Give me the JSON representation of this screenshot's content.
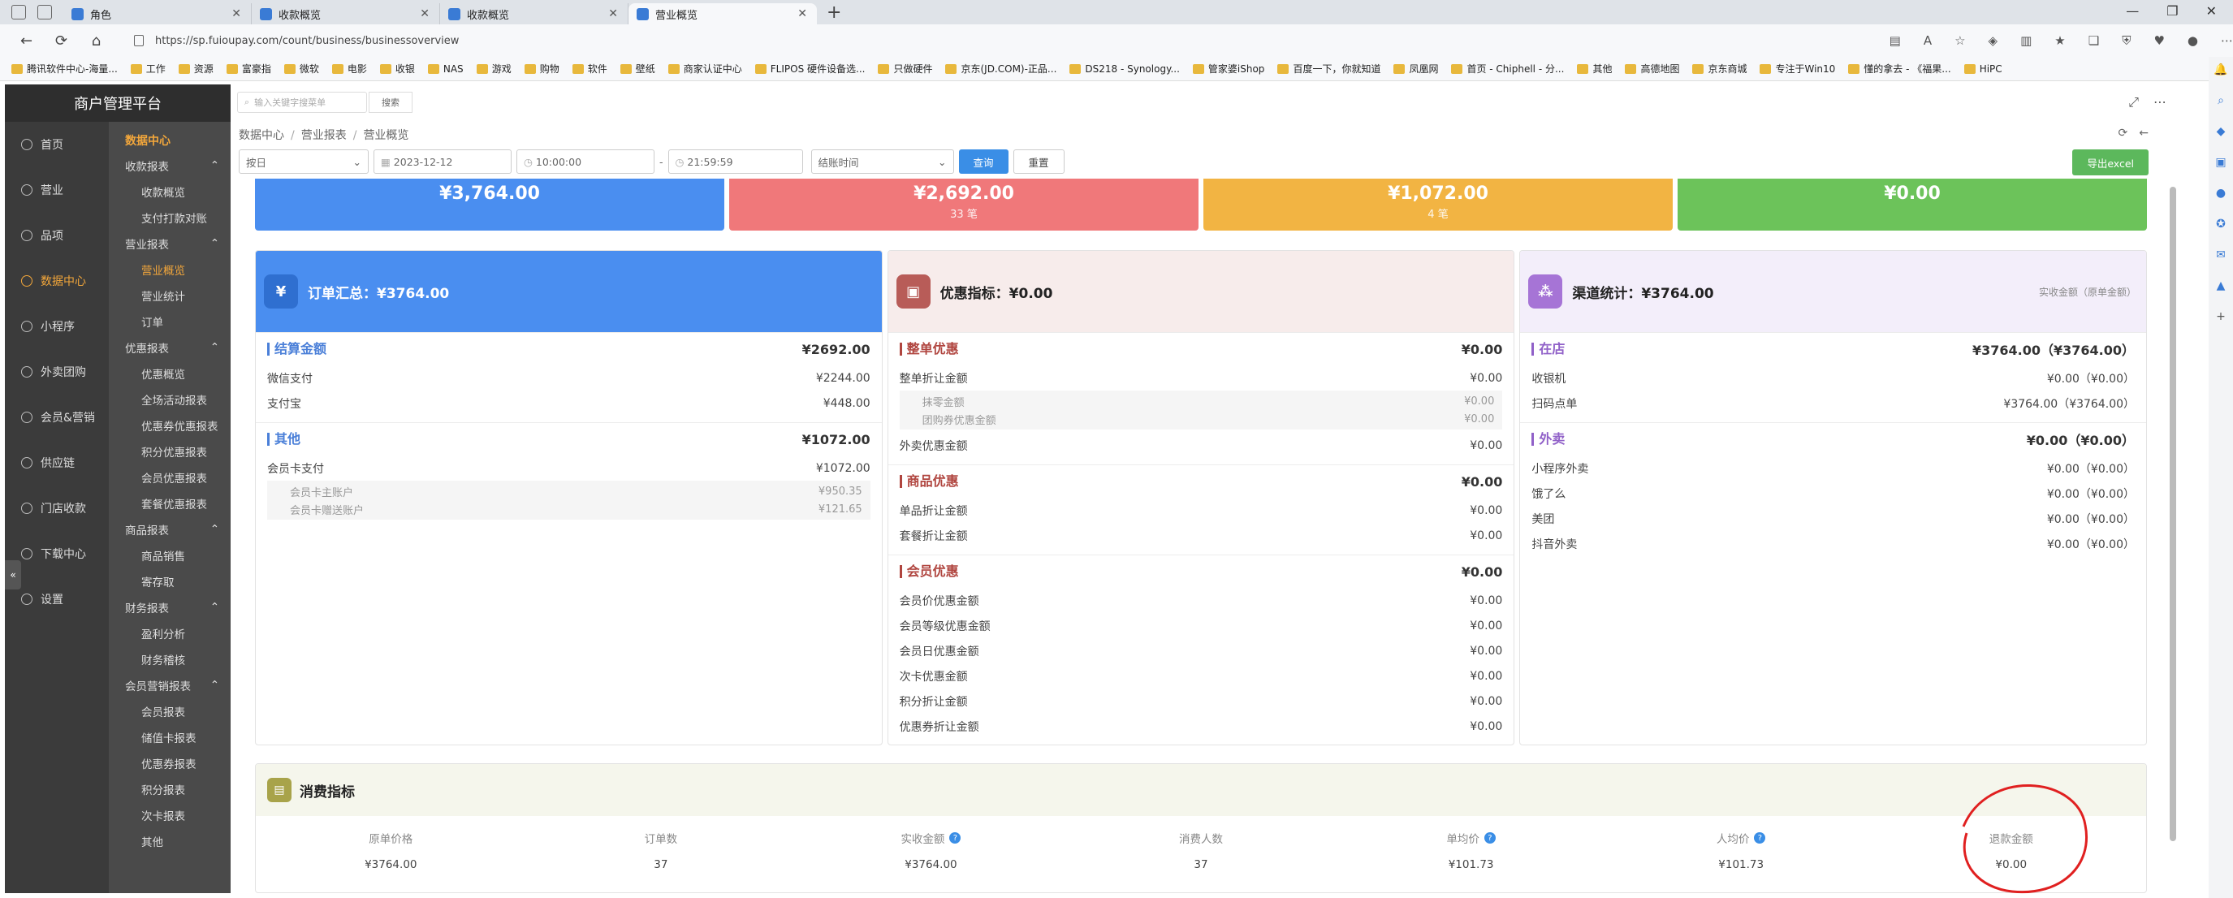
{
  "browser": {
    "tabs": [
      {
        "label": "角色"
      },
      {
        "label": "收款概览"
      },
      {
        "label": "收款概览"
      },
      {
        "label": "营业概览"
      }
    ],
    "url": "https://sp.fuioupay.com/count/business/businessoverview",
    "bookmarks": [
      "腾讯软件中心-海量...",
      "工作",
      "资源",
      "富豪指",
      "微软",
      "电影",
      "收银",
      "NAS",
      "游戏",
      "购物",
      "软件",
      "壁纸",
      "商家认证中心",
      "FLIPOS 硬件设备选...",
      "只做硬件",
      "京东(JD.COM)-正品...",
      "DS218 - Synology...",
      "管家婆iShop",
      "百度一下，你就知道",
      "凤凰网",
      "首页 - Chiphell - 分...",
      "其他",
      "高德地图",
      "京东商城",
      "专注于Win10",
      "懂的拿去 - 《福果...",
      "HiPC"
    ]
  },
  "app": {
    "title": "商户管理平台",
    "search_placeholder": "输入关键字搜菜单",
    "search_button": "搜索"
  },
  "sidebar": {
    "items": [
      {
        "label": "首页",
        "icon": "home-icon"
      },
      {
        "label": "营业",
        "icon": "business-icon"
      },
      {
        "label": "品项",
        "icon": "goods-icon"
      },
      {
        "label": "数据中心",
        "icon": "data-icon",
        "active": true
      },
      {
        "label": "小程序",
        "icon": "miniapp-icon"
      },
      {
        "label": "外卖团购",
        "icon": "delivery-icon"
      },
      {
        "label": "会员&营销",
        "icon": "member-icon"
      },
      {
        "label": "供应链",
        "icon": "supply-icon"
      },
      {
        "label": "门店收款",
        "icon": "store-icon"
      },
      {
        "label": "下载中心",
        "icon": "download-icon"
      },
      {
        "label": "设置",
        "icon": "settings-icon"
      }
    ]
  },
  "submenu": {
    "header": "数据中心",
    "entries": [
      {
        "type": "group",
        "label": "收款报表"
      },
      {
        "type": "link",
        "label": "收款概览"
      },
      {
        "type": "link",
        "label": "支付打款对账"
      },
      {
        "type": "group",
        "label": "营业报表"
      },
      {
        "type": "link",
        "label": "营业概览",
        "active": true
      },
      {
        "type": "link",
        "label": "营业统计"
      },
      {
        "type": "link",
        "label": "订单"
      },
      {
        "type": "group",
        "label": "优惠报表"
      },
      {
        "type": "link",
        "label": "优惠概览"
      },
      {
        "type": "link",
        "label": "全场活动报表"
      },
      {
        "type": "link",
        "label": "优惠券优惠报表"
      },
      {
        "type": "link",
        "label": "积分优惠报表"
      },
      {
        "type": "link",
        "label": "会员优惠报表"
      },
      {
        "type": "link",
        "label": "套餐优惠报表"
      },
      {
        "type": "group",
        "label": "商品报表"
      },
      {
        "type": "link",
        "label": "商品销售"
      },
      {
        "type": "link",
        "label": "寄存取"
      },
      {
        "type": "group",
        "label": "财务报表"
      },
      {
        "type": "link",
        "label": "盈利分析"
      },
      {
        "type": "link",
        "label": "财务稽核"
      },
      {
        "type": "group",
        "label": "会员营销报表"
      },
      {
        "type": "link",
        "label": "会员报表"
      },
      {
        "type": "link",
        "label": "储值卡报表"
      },
      {
        "type": "link",
        "label": "优惠券报表"
      },
      {
        "type": "link",
        "label": "积分报表"
      },
      {
        "type": "link",
        "label": "次卡报表"
      },
      {
        "type": "link",
        "label": "其他"
      }
    ]
  },
  "breadcrumb": [
    "数据中心",
    "营业报表",
    "营业概览"
  ],
  "filters": {
    "period": "按日",
    "date": "2023-12-12",
    "start_time": "10:00:00",
    "end_time": "21:59:59",
    "time_type": "结账时间",
    "query": "查询",
    "reset": "重置",
    "export": "导出excel"
  },
  "stats": [
    {
      "value": "¥3,764.00",
      "sub": "",
      "color": "#4a8ef0"
    },
    {
      "value": "¥2,692.00",
      "sub": "33 笔",
      "color": "#f0787a"
    },
    {
      "value": "¥1,072.00",
      "sub": "4 笔",
      "color": "#f2b443"
    },
    {
      "value": "¥0.00",
      "sub": "",
      "color": "#6cc35a"
    }
  ],
  "order_card": {
    "title": "订单汇总：¥3764.00",
    "sections": [
      {
        "title": "结算金额",
        "total": "¥2692.00",
        "rows": [
          {
            "label": "微信支付",
            "value": "¥2244.00"
          },
          {
            "label": "支付宝",
            "value": "¥448.00"
          }
        ]
      },
      {
        "title": "其他",
        "total": "¥1072.00",
        "rows": [
          {
            "label": "会员卡支付",
            "value": "¥1072.00"
          }
        ],
        "subrows": [
          {
            "label": "会员卡主账户",
            "value": "¥950.35"
          },
          {
            "label": "会员卡赠送账户",
            "value": "¥121.65"
          }
        ]
      }
    ]
  },
  "discount_card": {
    "title": "优惠指标：¥0.00",
    "sections": [
      {
        "title": "整单优惠",
        "total": "¥0.00",
        "rows": [
          {
            "label": "整单折让金额",
            "value": "¥0.00"
          }
        ],
        "subrows": [
          {
            "label": "抹零金额",
            "value": "¥0.00"
          },
          {
            "label": "团购券优惠金额",
            "value": "¥0.00"
          }
        ],
        "after": [
          {
            "label": "外卖优惠金额",
            "value": "¥0.00"
          }
        ]
      },
      {
        "title": "商品优惠",
        "total": "¥0.00",
        "rows": [
          {
            "label": "单品折让金额",
            "value": "¥0.00"
          },
          {
            "label": "套餐折让金额",
            "value": "¥0.00"
          }
        ]
      },
      {
        "title": "会员优惠",
        "total": "¥0.00",
        "rows": [
          {
            "label": "会员价优惠金额",
            "value": "¥0.00"
          },
          {
            "label": "会员等级优惠金额",
            "value": "¥0.00"
          },
          {
            "label": "会员日优惠金额",
            "value": "¥0.00"
          },
          {
            "label": "次卡优惠金额",
            "value": "¥0.00"
          },
          {
            "label": "积分折让金额",
            "value": "¥0.00"
          },
          {
            "label": "优惠券折让金额",
            "value": "¥0.00"
          }
        ]
      }
    ]
  },
  "channel_card": {
    "title": "渠道统计：¥3764.00",
    "note": "实收金额（原单金额）",
    "sections": [
      {
        "title": "在店",
        "total": "¥3764.00（¥3764.00）",
        "rows": [
          {
            "label": "收银机",
            "value": "¥0.00（¥0.00）"
          },
          {
            "label": "扫码点单",
            "value": "¥3764.00（¥3764.00）"
          }
        ]
      },
      {
        "title": "外卖",
        "total": "¥0.00（¥0.00）",
        "rows": [
          {
            "label": "小程序外卖",
            "value": "¥0.00（¥0.00）"
          },
          {
            "label": "饿了么",
            "value": "¥0.00（¥0.00）"
          },
          {
            "label": "美团",
            "value": "¥0.00（¥0.00）"
          },
          {
            "label": "抖音外卖",
            "value": "¥0.00（¥0.00）"
          }
        ]
      }
    ]
  },
  "consume": {
    "title": "消费指标",
    "headers": [
      "原单价格",
      "订单数",
      "实收金额",
      "消费人数",
      "单均价",
      "人均价",
      "退款金额"
    ],
    "values": [
      "¥3764.00",
      "37",
      "¥3764.00",
      "37",
      "¥101.73",
      "¥101.73",
      "¥0.00"
    ],
    "help": [
      false,
      false,
      true,
      false,
      true,
      true,
      false
    ]
  }
}
